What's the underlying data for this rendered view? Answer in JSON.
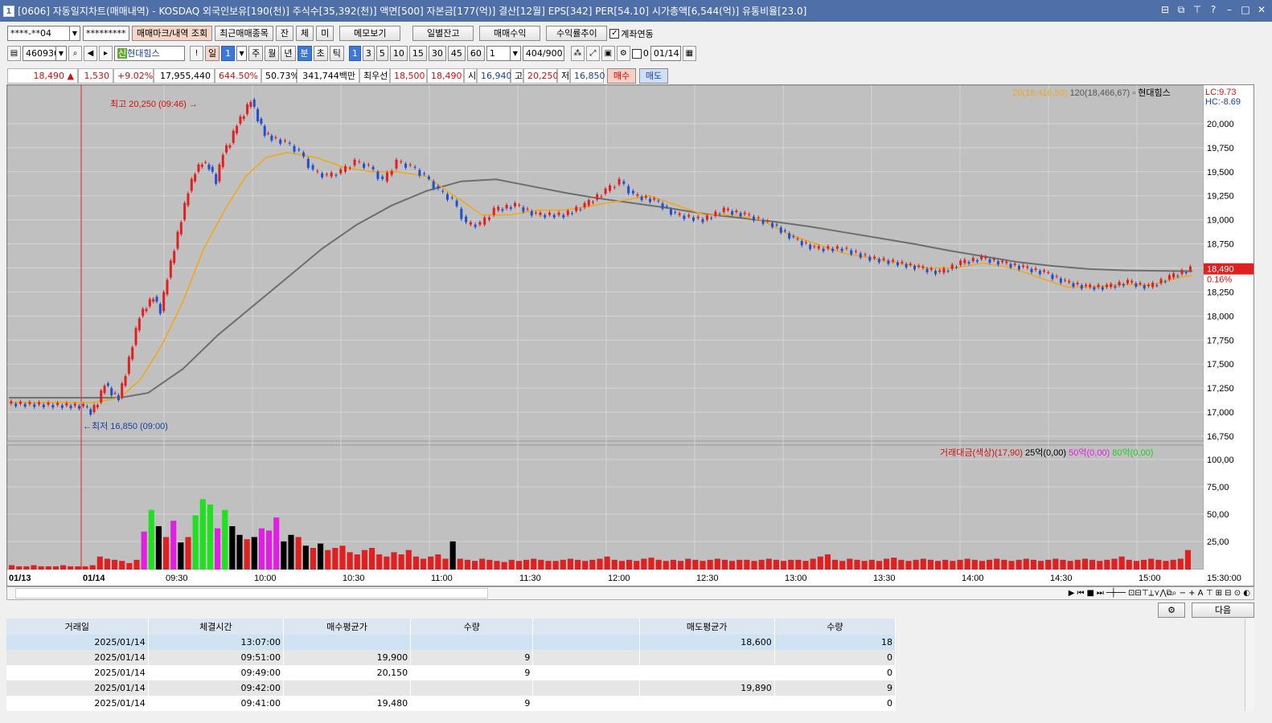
{
  "title": "[0606] 자동일지차트(매매내역) - KOSDAQ 외국인보유[190(천)] 주식수[35,392(천)] 액면[500] 자본금[177(억)] 결산[12월] EPS[342] PER[54.10] 시가총액[6,544(억)] 유통비율[23.0]",
  "toolbar1": {
    "account": "****-**04",
    "password": "*********",
    "btn_mark": "매매마크/내역 조회",
    "btn_recent": "최근매매종목",
    "btn_jan": "잔",
    "btn_che": "체",
    "btn_mi": "미",
    "btn_memo": "메모보기",
    "btn_daily": "일별잔고",
    "btn_profit": "매매수익",
    "btn_rate": "수익률추이",
    "chk_link": "계좌연동"
  },
  "toolbar2": {
    "code": "460930",
    "name": "현대힘스",
    "day": "일",
    "daynum": "1",
    "periods": [
      "주",
      "월",
      "년",
      "분",
      "초",
      "틱"
    ],
    "intervals": [
      "1",
      "3",
      "5",
      "10",
      "15",
      "30",
      "45",
      "60"
    ],
    "interval_sel": "1",
    "count": "404",
    "count_total": "/900",
    "date": "01/14",
    "zero": "0"
  },
  "quote": {
    "price": "18,490 ▲",
    "change": "1,530",
    "rate": "+9.02%",
    "volume": "17,955,440",
    "vol_rate": "644.50%",
    "ratio": "50.73%",
    "amount": "341,744백만",
    "best_label": "최우선",
    "best_sell": "18,500",
    "best_buy": "18,490",
    "open_label": "시",
    "open": "16,940",
    "high_label": "고",
    "high": "20,250",
    "low_label": "저",
    "low": "16,850",
    "buy": "매수",
    "sell": "매도"
  },
  "chart_data": {
    "type": "line",
    "title": "",
    "y_ticks": [
      "20,000",
      "19,750",
      "19,500",
      "19,250",
      "19,000",
      "18,750",
      "18,500",
      "18,250",
      "18,000",
      "17,750",
      "17,500",
      "17,250",
      "17,000",
      "16,750"
    ],
    "y_ticks_vol": [
      "100,00",
      "75,00",
      "50,00",
      "25,00"
    ],
    "x_ticks": [
      "01/13",
      "01/14",
      "09:30",
      "10:00",
      "10:30",
      "11:00",
      "11:30",
      "12:00",
      "12:30",
      "13:00",
      "13:30",
      "14:00",
      "14:30",
      "15:00",
      "15:30:00"
    ],
    "ylim": [
      16700,
      20400
    ],
    "legend_ma": [
      "20(18,416,50)",
      "120(18,466,67)",
      "현대힘스"
    ],
    "lc": "LC:9.73",
    "hc": "HC:-8.69",
    "last_price": "18,490",
    "last_pct": "0.16%",
    "legend_vol": [
      "거래대금(색상)(17,90)",
      "25억(0,00)",
      "50억(0,00)",
      "80억(0,00)"
    ],
    "annot_high": "최고 20,250 (09:46)",
    "annot_low": "최저 16,850 (09:00)",
    "price_series": [
      [
        0,
        17090
      ],
      [
        4,
        17080
      ],
      [
        8,
        17070
      ],
      [
        11,
        17060
      ],
      [
        12,
        17000
      ],
      [
        13,
        17100
      ],
      [
        14,
        17300
      ],
      [
        15,
        17200
      ],
      [
        16,
        17150
      ],
      [
        17,
        17400
      ],
      [
        18,
        17700
      ],
      [
        19,
        18000
      ],
      [
        20,
        18100
      ],
      [
        21,
        18200
      ],
      [
        22,
        18050
      ],
      [
        23,
        18400
      ],
      [
        24,
        18700
      ],
      [
        25,
        19000
      ],
      [
        26,
        19300
      ],
      [
        27,
        19500
      ],
      [
        28,
        19600
      ],
      [
        29,
        19550
      ],
      [
        30,
        19400
      ],
      [
        31,
        19700
      ],
      [
        32,
        19800
      ],
      [
        33,
        20000
      ],
      [
        34,
        20100
      ],
      [
        35,
        20250
      ],
      [
        36,
        20050
      ],
      [
        37,
        19900
      ],
      [
        38,
        19850
      ],
      [
        40,
        19800
      ],
      [
        42,
        19700
      ],
      [
        44,
        19500
      ],
      [
        46,
        19450
      ],
      [
        48,
        19500
      ],
      [
        50,
        19600
      ],
      [
        52,
        19550
      ],
      [
        54,
        19400
      ],
      [
        56,
        19600
      ],
      [
        58,
        19550
      ],
      [
        60,
        19450
      ],
      [
        62,
        19300
      ],
      [
        64,
        19200
      ],
      [
        66,
        18950
      ],
      [
        68,
        18950
      ],
      [
        70,
        19100
      ],
      [
        73,
        19150
      ],
      [
        76,
        19050
      ],
      [
        80,
        19050
      ],
      [
        83,
        19150
      ],
      [
        86,
        19300
      ],
      [
        88,
        19400
      ],
      [
        90,
        19250
      ],
      [
        93,
        19200
      ],
      [
        96,
        19050
      ],
      [
        100,
        19000
      ],
      [
        103,
        19100
      ],
      [
        106,
        19050
      ],
      [
        110,
        18950
      ],
      [
        113,
        18800
      ],
      [
        116,
        18700
      ],
      [
        120,
        18700
      ],
      [
        124,
        18600
      ],
      [
        128,
        18550
      ],
      [
        131,
        18500
      ],
      [
        134,
        18450
      ],
      [
        137,
        18550
      ],
      [
        140,
        18600
      ],
      [
        143,
        18550
      ],
      [
        146,
        18500
      ],
      [
        149,
        18450
      ],
      [
        152,
        18350
      ],
      [
        155,
        18300
      ],
      [
        158,
        18300
      ],
      [
        161,
        18350
      ],
      [
        164,
        18300
      ],
      [
        167,
        18400
      ],
      [
        170,
        18490
      ]
    ],
    "ma20_series": [
      [
        0,
        17100
      ],
      [
        12,
        17100
      ],
      [
        16,
        17150
      ],
      [
        19,
        17350
      ],
      [
        22,
        17700
      ],
      [
        25,
        18150
      ],
      [
        28,
        18700
      ],
      [
        31,
        19100
      ],
      [
        34,
        19450
      ],
      [
        37,
        19650
      ],
      [
        40,
        19700
      ],
      [
        44,
        19650
      ],
      [
        48,
        19550
      ],
      [
        52,
        19500
      ],
      [
        56,
        19500
      ],
      [
        60,
        19450
      ],
      [
        64,
        19250
      ],
      [
        68,
        19050
      ],
      [
        72,
        19050
      ],
      [
        76,
        19100
      ],
      [
        80,
        19100
      ],
      [
        84,
        19150
      ],
      [
        88,
        19200
      ],
      [
        92,
        19250
      ],
      [
        96,
        19150
      ],
      [
        100,
        19050
      ],
      [
        104,
        19050
      ],
      [
        108,
        19000
      ],
      [
        112,
        18850
      ],
      [
        116,
        18750
      ],
      [
        120,
        18650
      ],
      [
        124,
        18600
      ],
      [
        128,
        18550
      ],
      [
        132,
        18500
      ],
      [
        136,
        18500
      ],
      [
        140,
        18550
      ],
      [
        144,
        18500
      ],
      [
        148,
        18400
      ],
      [
        152,
        18300
      ],
      [
        156,
        18300
      ],
      [
        160,
        18330
      ],
      [
        164,
        18320
      ],
      [
        168,
        18400
      ],
      [
        170,
        18420
      ]
    ],
    "ma120_series": [
      [
        0,
        17150
      ],
      [
        12,
        17150
      ],
      [
        16,
        17150
      ],
      [
        20,
        17200
      ],
      [
        25,
        17450
      ],
      [
        30,
        17800
      ],
      [
        35,
        18100
      ],
      [
        40,
        18400
      ],
      [
        45,
        18700
      ],
      [
        50,
        18950
      ],
      [
        55,
        19150
      ],
      [
        60,
        19300
      ],
      [
        65,
        19400
      ],
      [
        70,
        19420
      ],
      [
        75,
        19350
      ],
      [
        80,
        19280
      ],
      [
        85,
        19220
      ],
      [
        90,
        19170
      ],
      [
        95,
        19120
      ],
      [
        100,
        19060
      ],
      [
        105,
        19020
      ],
      [
        110,
        18980
      ],
      [
        115,
        18930
      ],
      [
        120,
        18870
      ],
      [
        125,
        18810
      ],
      [
        130,
        18750
      ],
      [
        135,
        18680
      ],
      [
        140,
        18620
      ],
      [
        145,
        18560
      ],
      [
        150,
        18520
      ],
      [
        155,
        18490
      ],
      [
        160,
        18475
      ],
      [
        165,
        18470
      ],
      [
        170,
        18466
      ]
    ],
    "volume_heights": [
      4,
      3,
      3,
      4,
      3,
      3,
      3,
      4,
      3,
      3,
      3,
      4,
      12,
      10,
      9,
      8,
      6,
      9,
      35,
      55,
      40,
      30,
      45,
      25,
      30,
      50,
      65,
      60,
      38,
      55,
      40,
      32,
      28,
      30,
      38,
      36,
      48,
      26,
      32,
      30,
      22,
      20,
      24,
      18,
      20,
      22,
      16,
      14,
      18,
      20,
      14,
      12,
      16,
      14,
      18,
      12,
      10,
      12,
      14,
      10,
      26,
      10,
      9,
      8,
      10,
      9,
      8,
      7,
      9,
      8,
      9,
      10,
      9,
      8,
      8,
      9,
      10,
      9,
      8,
      9,
      10,
      12,
      9,
      8,
      9,
      8,
      10,
      11,
      9,
      8,
      9,
      8,
      10,
      9,
      8,
      9,
      10,
      9,
      8,
      9,
      9,
      8,
      9,
      10,
      9,
      8,
      9,
      9,
      8,
      10,
      12,
      14,
      9,
      8,
      10,
      9,
      8,
      9,
      8,
      10,
      11,
      9,
      8,
      9,
      10,
      9,
      8,
      9,
      8,
      9,
      10,
      9,
      8,
      9,
      10,
      9,
      8,
      9,
      10,
      9,
      8,
      9,
      10,
      9,
      8,
      9,
      10,
      9,
      8,
      9,
      10,
      12,
      9,
      8,
      9,
      10,
      9,
      8,
      9,
      10,
      18
    ],
    "volume_colors": [
      "r",
      "r",
      "r",
      "r",
      "r",
      "r",
      "r",
      "r",
      "r",
      "r",
      "r",
      "r",
      "r",
      "r",
      "r",
      "r",
      "r",
      "r",
      "m",
      "g",
      "k",
      "r",
      "m",
      "k",
      "r",
      "g",
      "g",
      "g",
      "m",
      "g",
      "k",
      "k",
      "r",
      "k",
      "m",
      "m",
      "m",
      "k",
      "k",
      "r",
      "k",
      "r",
      "k",
      "r",
      "r",
      "r",
      "r",
      "r",
      "r",
      "r",
      "r",
      "r",
      "r",
      "r",
      "r",
      "r",
      "r",
      "r",
      "r",
      "r",
      "k"
    ]
  },
  "trades": {
    "columns": [
      "거래일",
      "체결시간",
      "매수평균가",
      "수량",
      "",
      "매도평균가",
      "수량"
    ],
    "rows": [
      [
        "2025/01/14",
        "13:07:00",
        "",
        "",
        "",
        "18,600",
        "18"
      ],
      [
        "2025/01/14",
        "09:51:00",
        "19,900",
        "9",
        "",
        "",
        "0"
      ],
      [
        "2025/01/14",
        "09:49:00",
        "20,150",
        "9",
        "",
        "",
        "0"
      ],
      [
        "2025/01/14",
        "09:42:00",
        "",
        "",
        "",
        "19,890",
        "9"
      ],
      [
        "2025/01/14",
        "09:41:00",
        "19,480",
        "9",
        "",
        "",
        "0"
      ]
    ],
    "next": "다음"
  }
}
